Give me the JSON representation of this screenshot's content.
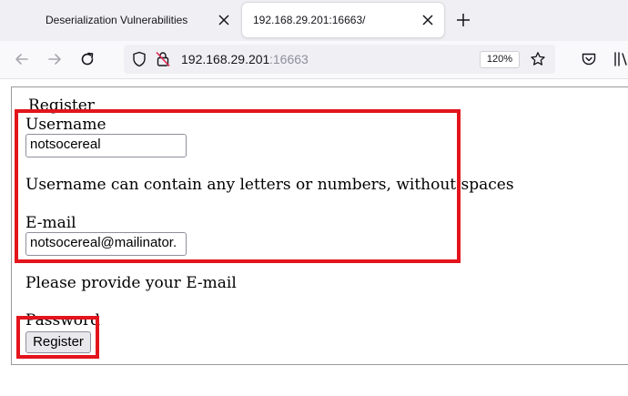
{
  "browser": {
    "tabs": [
      {
        "title": "Deserialization Vulnerabilities",
        "active": false
      },
      {
        "title": "192.168.29.201:16663/",
        "active": true
      }
    ],
    "url_host": "192.168.29.201",
    "url_port": ":16663",
    "zoom": "120%"
  },
  "form": {
    "heading": "Register",
    "username_label": "Username",
    "username_value": "notsocereal",
    "username_hint": "Username can contain any letters or numbers, without spaces",
    "email_label": "E-mail",
    "email_value": "notsocereal@mailinator.",
    "email_hint": "Please provide your E-mail",
    "password_label": "Password",
    "register_button": "Register"
  },
  "colors": {
    "highlight": "#e3141c",
    "tabstrip_bg": "#f0f0f4",
    "navbar_bg": "#f9f9fb",
    "url_port_color": "#8f8f9d"
  },
  "icons": [
    "close-icon",
    "plus-icon",
    "back-arrow-icon",
    "forward-arrow-icon",
    "reload-icon",
    "shield-icon",
    "insecure-lock-icon",
    "star-icon",
    "pocket-icon",
    "library-icon"
  ]
}
